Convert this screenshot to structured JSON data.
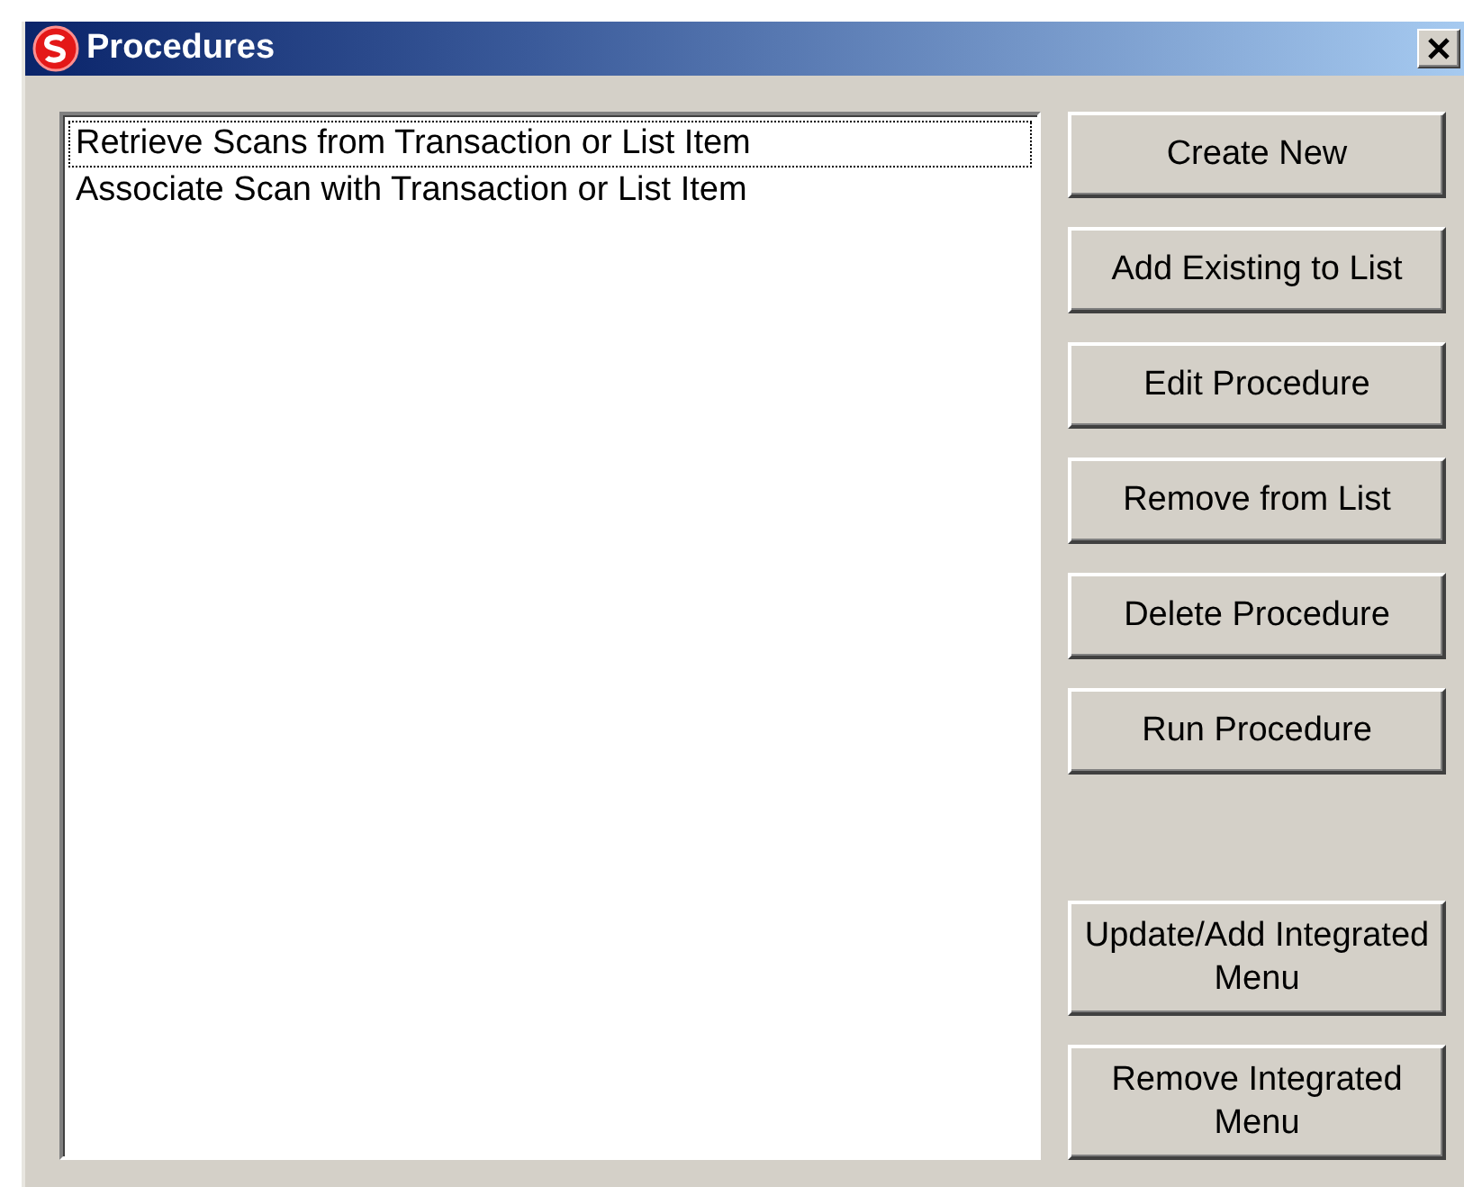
{
  "window": {
    "title": "Procedures"
  },
  "procedures": [
    {
      "label": "Retrieve Scans from Transaction or List Item",
      "focused": true
    },
    {
      "label": "Associate Scan with Transaction or List Item",
      "focused": false
    }
  ],
  "buttons": [
    "Create New",
    "Add Existing to List",
    "Edit Procedure",
    "Remove from List",
    "Delete Procedure",
    "Run Procedure"
  ],
  "menu_buttons": [
    "Update/Add Integrated Menu",
    "Remove Integrated Menu"
  ]
}
